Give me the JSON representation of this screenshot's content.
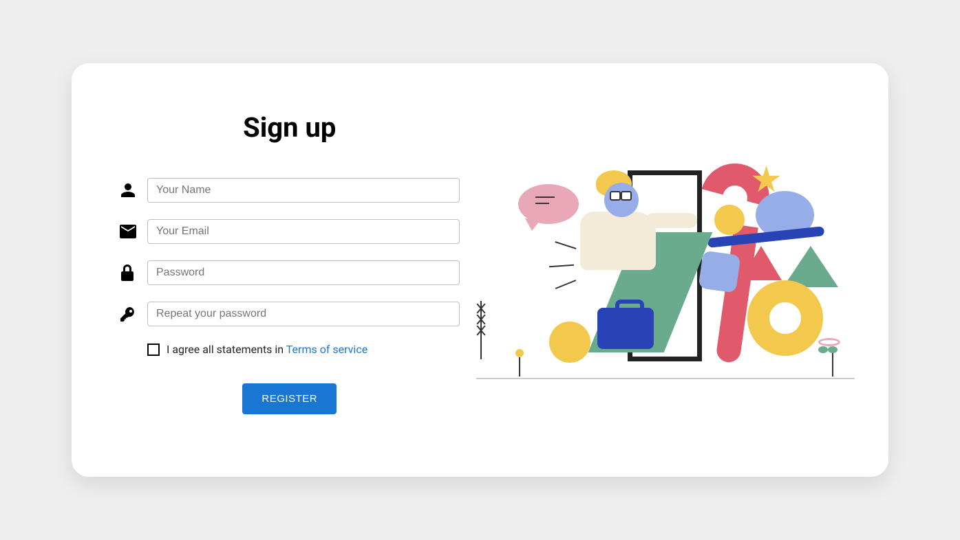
{
  "title": "Sign up",
  "fields": {
    "name": {
      "placeholder": "Your Name"
    },
    "email": {
      "placeholder": "Your Email"
    },
    "password": {
      "placeholder": "Password"
    },
    "repeat": {
      "placeholder": "Repeat your password"
    }
  },
  "agree": {
    "prefix": "I agree all statements in ",
    "link": "Terms of service"
  },
  "register_label": "Register"
}
